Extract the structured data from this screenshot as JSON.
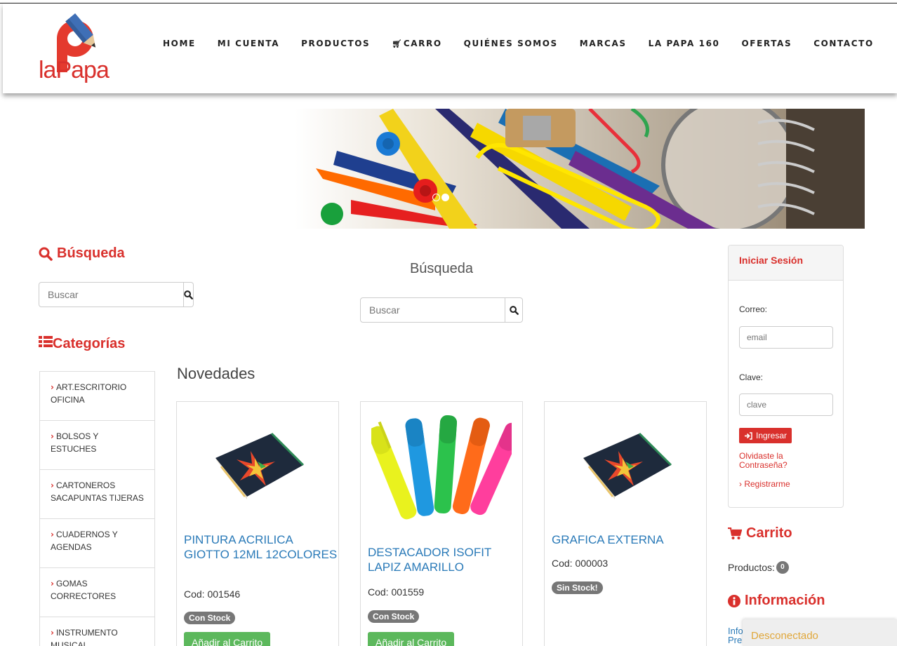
{
  "brand": {
    "logo_text_a": "la",
    "logo_text_b": "Papa",
    "colors": {
      "accent": "#d9302c",
      "link": "#2a7ab8",
      "success": "#5cb85c",
      "muted_badge": "#777777"
    }
  },
  "nav": {
    "items": [
      {
        "label": "HOME",
        "icon": ""
      },
      {
        "label": "MI CUENTA",
        "icon": ""
      },
      {
        "label": "PRODUCTOS",
        "icon": ""
      },
      {
        "label": "CARRO",
        "icon": "cart-icon"
      },
      {
        "label": "QUIÉNES SOMOS",
        "icon": ""
      },
      {
        "label": "MARCAS",
        "icon": ""
      },
      {
        "label": "LA PAPA 160",
        "icon": ""
      },
      {
        "label": "OFERTAS",
        "icon": ""
      },
      {
        "label": "CONTACTO",
        "icon": ""
      }
    ]
  },
  "banner": {
    "slides": 2,
    "active_slide": 2
  },
  "left": {
    "search_title": "Búsqueda",
    "search_placeholder": "Buscar",
    "categories_title": "Categorías",
    "categories": [
      "ART.ESCRITORIO OFICINA",
      "BOLSOS Y ESTUCHES",
      "CARTONEROS SACAPUNTAS TIJERAS",
      "CUADERNOS Y AGENDAS",
      "GOMAS CORRECTORES",
      "INSTRUMENTO MUSICAL"
    ]
  },
  "center": {
    "search_title": "Búsqueda",
    "search_placeholder": "Buscar",
    "novedades_title": "Novedades",
    "products": [
      {
        "name": "PINTURA ACRILICA GIOTTO 12ML 12COLORES",
        "code": "Cod: 001546",
        "stock": "Con Stock",
        "button": "Añadir al Carrito",
        "image": "notebook-image"
      },
      {
        "name": "DESTACADOR ISOFIT LAPIZ AMARILLO",
        "code": "Cod: 001559",
        "stock": "Con Stock",
        "button": "Añadir al Carrito",
        "image": "highlighters-image"
      },
      {
        "name": "GRAFICA EXTERNA",
        "code": "Cod: 000003",
        "stock": "Sin Stock!",
        "button": "",
        "image": "notebook-image"
      }
    ]
  },
  "right": {
    "login_title": "Iniciar Sesión",
    "email_label": "Correo:",
    "email_placeholder": "email",
    "password_label": "Clave:",
    "password_placeholder": "clave",
    "login_button": "Ingresar",
    "forgot_line1": "Olvidaste la",
    "forgot_line2": "Contraseña?",
    "register": "› Registrarme",
    "cart_title": "Carrito",
    "products_label": "Productos:",
    "products_count": "0",
    "info_title": "Información",
    "info_link_1": "Info",
    "info_link_2": "Pre"
  },
  "status_popup": "Desconectado"
}
